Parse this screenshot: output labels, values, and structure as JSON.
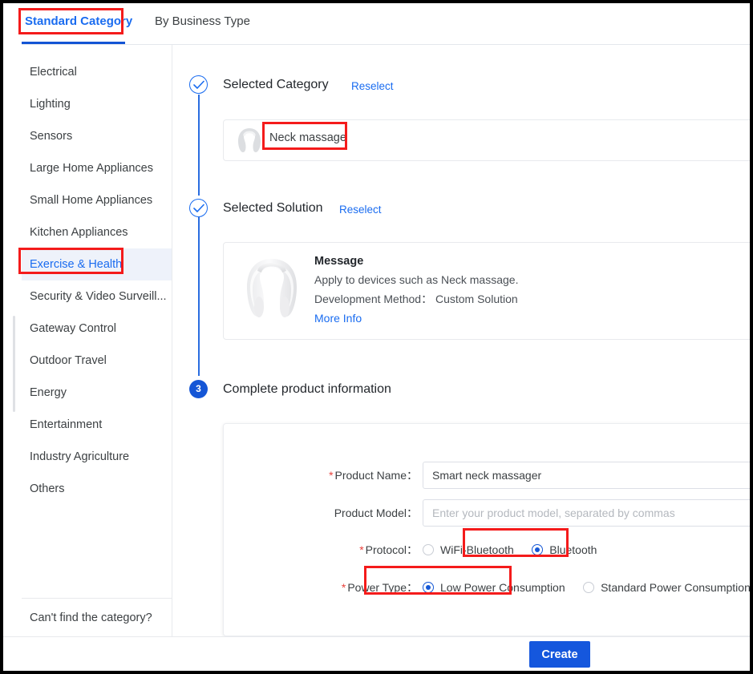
{
  "tabs": [
    {
      "label": "Standard Category",
      "active": true
    },
    {
      "label": "By Business Type",
      "active": false
    }
  ],
  "sidebar": {
    "items": [
      {
        "label": "Electrical"
      },
      {
        "label": "Lighting"
      },
      {
        "label": "Sensors"
      },
      {
        "label": "Large Home Appliances"
      },
      {
        "label": "Small Home Appliances"
      },
      {
        "label": "Kitchen Appliances"
      },
      {
        "label": "Exercise & Health"
      },
      {
        "label": "Security & Video Surveill..."
      },
      {
        "label": "Gateway Control"
      },
      {
        "label": "Outdoor Travel"
      },
      {
        "label": "Energy"
      },
      {
        "label": "Entertainment"
      },
      {
        "label": "Industry Agriculture"
      },
      {
        "label": "Others"
      }
    ],
    "selected_index": 6,
    "footer_link": "Can't find the category?"
  },
  "steps": {
    "step1": {
      "title": "Selected Category",
      "reselect": "Reselect",
      "icon": "check-circle-icon",
      "card": {
        "icon": "neck-massager-icon",
        "name": "Neck massage"
      }
    },
    "step2": {
      "title": "Selected Solution",
      "reselect": "Reselect",
      "icon": "check-circle-icon",
      "card": {
        "image": "neck-massager-photo",
        "title": "Message",
        "line1": "Apply to devices such as Neck massage.",
        "line2": "Development Method： Custom Solution",
        "more": "More Info"
      }
    },
    "step3": {
      "number": "3",
      "title": "Complete product information"
    }
  },
  "form": {
    "product_name": {
      "label": "Product Name：",
      "required": true,
      "value": "Smart neck massager",
      "placeholder": ""
    },
    "product_model": {
      "label": "Product Model：",
      "required": false,
      "value": "",
      "placeholder": "Enter your product model, separated by commas"
    },
    "protocol": {
      "label": "Protocol：",
      "required": true,
      "options": [
        {
          "label": "WiFi-Bluetooth",
          "selected": false
        },
        {
          "label": "Bluetooth",
          "selected": true
        }
      ]
    },
    "power_type": {
      "label": "Power Type：",
      "required": true,
      "options": [
        {
          "label": "Low Power Consumption",
          "selected": true
        },
        {
          "label": "Standard Power Consumption",
          "selected": false
        }
      ]
    }
  },
  "footer": {
    "create_label": "Create"
  },
  "colors": {
    "accent_blue": "#1a6cf0",
    "button_blue": "#1557dd",
    "highlight_red": "#f41b1b",
    "required_red": "#e8413c",
    "selected_row_bg": "#eef2fa"
  }
}
